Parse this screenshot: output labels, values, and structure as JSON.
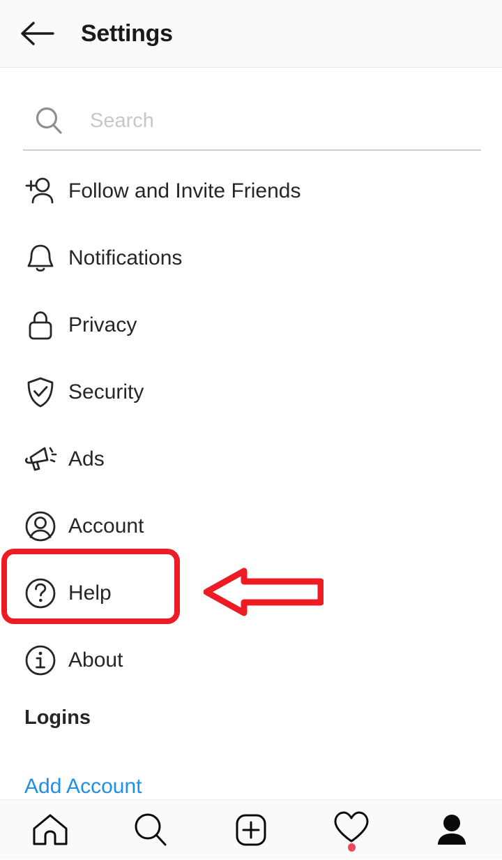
{
  "header": {
    "title": "Settings",
    "back_icon": "back-arrow-icon"
  },
  "search": {
    "placeholder": "Search",
    "value": "",
    "icon": "search-icon"
  },
  "settings": {
    "items": [
      {
        "label": "Follow and Invite Friends",
        "icon": "add-person-icon"
      },
      {
        "label": "Notifications",
        "icon": "bell-icon"
      },
      {
        "label": "Privacy",
        "icon": "lock-icon"
      },
      {
        "label": "Security",
        "icon": "shield-check-icon"
      },
      {
        "label": "Ads",
        "icon": "megaphone-icon"
      },
      {
        "label": "Account",
        "icon": "account-circle-icon"
      },
      {
        "label": "Help",
        "icon": "question-circle-icon"
      },
      {
        "label": "About",
        "icon": "info-circle-icon"
      }
    ]
  },
  "logins": {
    "heading": "Logins",
    "add_account": "Add Account"
  },
  "bottom_nav": {
    "items": [
      {
        "name": "home",
        "icon": "home-icon",
        "active": false,
        "badge": false
      },
      {
        "name": "search",
        "icon": "search-icon",
        "active": false,
        "badge": false
      },
      {
        "name": "create",
        "icon": "plus-square-icon",
        "active": false,
        "badge": false
      },
      {
        "name": "activity",
        "icon": "heart-icon",
        "active": false,
        "badge": true
      },
      {
        "name": "profile",
        "icon": "person-filled-icon",
        "active": true,
        "badge": false
      }
    ],
    "badge_color": "#ED4956"
  },
  "annotations": {
    "highlight_target": "Help",
    "highlight_color": "#ED1C24",
    "arrow_direction": "left"
  },
  "colors": {
    "header_bg": "#fafafa",
    "text_primary": "#262626",
    "link_blue": "#1e90e8",
    "placeholder": "#c7c7c7"
  }
}
